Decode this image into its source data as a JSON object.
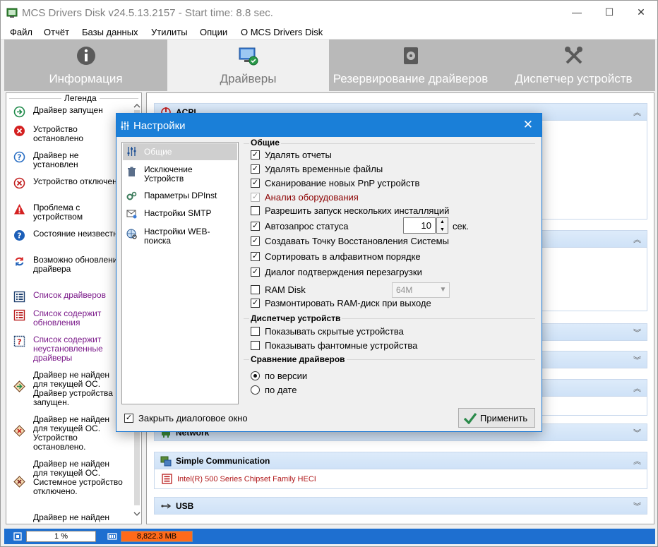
{
  "window": {
    "title": "MCS Drivers Disk v24.5.13.2157 - Start time: 8.8 sec.",
    "controls": [
      "—",
      "☐",
      "✕"
    ]
  },
  "menu": [
    "Файл",
    "Отчёт",
    "Базы данных",
    "Утилиты",
    "Опции",
    "О MCS Drivers Disk"
  ],
  "tabs": [
    {
      "label": "Информация",
      "icon": "info-icon"
    },
    {
      "label": "Драйверы",
      "icon": "drivers-icon",
      "active": true
    },
    {
      "label": "Резервирование драйверов",
      "icon": "backup-icon"
    },
    {
      "label": "Диспетчер устройств",
      "icon": "tools-icon"
    }
  ],
  "legend": {
    "title": "Легенда",
    "items": [
      {
        "text": "Драйвер запущен",
        "color": "#000000"
      },
      {
        "text": "Устройство остановлено",
        "color": "#000000"
      },
      {
        "text": "Драйвер не установлен",
        "color": "#000000"
      },
      {
        "text": "Устройство отключено",
        "color": "#000000"
      },
      {
        "text": "Проблема с устройством",
        "color": "#000000"
      },
      {
        "text": "Состояние неизвестно",
        "color": "#000000"
      },
      {
        "text": "Возможно обновление драйвера",
        "color": "#000000"
      },
      {
        "text": "Список драйверов",
        "color": "#7b1a8a"
      },
      {
        "text": "Список содержит обновления",
        "color": "#7b1a8a"
      },
      {
        "text": "Список содержит неустановленные драйверы",
        "color": "#7b1a8a"
      },
      {
        "text": "Драйвер не найден для текущей ОС. Драйвер устройства запущен.",
        "color": "#000000"
      },
      {
        "text": "Драйвер не найден для текущей ОС. Устройство остановлено.",
        "color": "#000000"
      },
      {
        "text": "Драйвер не найден для текущей ОС. Системное устройство отключено.",
        "color": "#000000"
      },
      {
        "text": "Драйвер не найден",
        "color": "#000000"
      }
    ]
  },
  "groups": {
    "acpi": "ACPI",
    "network": "Network",
    "simple_comm": "Simple Communication",
    "simple_comm_item": "Intel(R) 500 Series Chipset Family HECI",
    "usb": "USB"
  },
  "status": {
    "cpu": "1 %",
    "mem": "8,822.3 MB"
  },
  "dialog": {
    "title": "Настройки",
    "close": "✕",
    "nav": [
      {
        "label": "Общие",
        "active": true
      },
      {
        "label": "Исключение Устройств"
      },
      {
        "label": "Параметры DPInst"
      },
      {
        "label": "Настройки SMTP"
      },
      {
        "label": "Настройки WEB-поиска"
      }
    ],
    "general_title": "Общие",
    "options": [
      {
        "label": "Удалять отчеты",
        "checked": true
      },
      {
        "label": "Удалять временные файлы",
        "checked": true
      },
      {
        "label": "Сканирование новых PnP устройств",
        "checked": true
      },
      {
        "label": "Анализ оборудования",
        "checked": true,
        "disabled": true
      },
      {
        "label": "Разрешить запуск нескольких инсталляций",
        "checked": false
      },
      {
        "label": "Автозапрос статуса",
        "checked": true
      },
      {
        "label": "Создавать Точку Восстановления Системы",
        "checked": true
      },
      {
        "label": "Сортировать в алфавитном порядке",
        "checked": true
      },
      {
        "label": "Диалог подтверждения перезагрузки",
        "checked": true
      },
      {
        "label": "RAM Disk",
        "checked": false
      },
      {
        "label": "Размонтировать RAM-диск при выходе",
        "checked": true
      }
    ],
    "status_interval": "10",
    "status_unit": "сек.",
    "ramdisk_size": "64M",
    "devmgr_title": "Диспетчер устройств",
    "devmgr_options": [
      {
        "label": "Показывать скрытые устройства",
        "checked": false
      },
      {
        "label": "Показывать фантомные устройства",
        "checked": false
      }
    ],
    "compare_title": "Сравнение драйверов",
    "compare_options": [
      {
        "label": "по версии",
        "selected": true
      },
      {
        "label": "по дате",
        "selected": false
      }
    ],
    "close_dialog_label": "Закрыть диалоговое окно",
    "close_dialog_checked": true,
    "apply_label": "Применить"
  }
}
